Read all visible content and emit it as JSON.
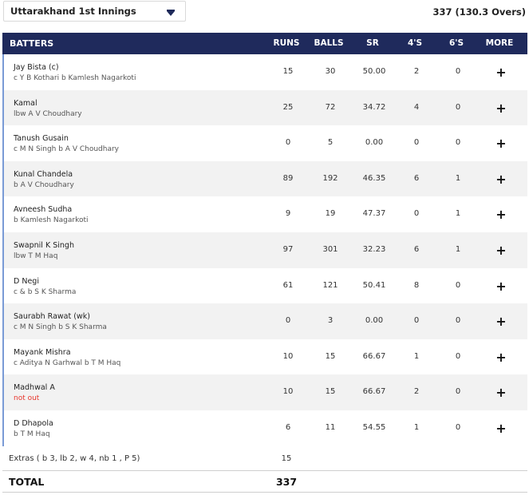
{
  "header": {
    "innings_select": "Uttarakhand 1st Innings",
    "score_summary": "337 (130.3 Overs)"
  },
  "columns": {
    "batters": "BATTERS",
    "runs": "RUNS",
    "balls": "BALLS",
    "sr": "SR",
    "fours": "4'S",
    "sixes": "6'S",
    "more": "MORE"
  },
  "batters": [
    {
      "name": "Jay Bista (c)",
      "dismissal": "c Y B Kothari b Kamlesh Nagarkoti",
      "runs": "15",
      "balls": "30",
      "sr": "50.00",
      "fours": "2",
      "sixes": "0"
    },
    {
      "name": "Kamal",
      "dismissal": "lbw A V Choudhary",
      "runs": "25",
      "balls": "72",
      "sr": "34.72",
      "fours": "4",
      "sixes": "0"
    },
    {
      "name": "Tanush Gusain",
      "dismissal": "c M N Singh b A V Choudhary",
      "runs": "0",
      "balls": "5",
      "sr": "0.00",
      "fours": "0",
      "sixes": "0"
    },
    {
      "name": "Kunal Chandela",
      "dismissal": "b A V Choudhary",
      "runs": "89",
      "balls": "192",
      "sr": "46.35",
      "fours": "6",
      "sixes": "1"
    },
    {
      "name": "Avneesh Sudha",
      "dismissal": "b Kamlesh Nagarkoti",
      "runs": "9",
      "balls": "19",
      "sr": "47.37",
      "fours": "0",
      "sixes": "1"
    },
    {
      "name": "Swapnil K Singh",
      "dismissal": "lbw T M Haq",
      "runs": "97",
      "balls": "301",
      "sr": "32.23",
      "fours": "6",
      "sixes": "1"
    },
    {
      "name": "D Negi",
      "dismissal": "c & b S K Sharma",
      "runs": "61",
      "balls": "121",
      "sr": "50.41",
      "fours": "8",
      "sixes": "0"
    },
    {
      "name": "Saurabh Rawat (wk)",
      "dismissal": "c M N Singh b S K Sharma",
      "runs": "0",
      "balls": "3",
      "sr": "0.00",
      "fours": "0",
      "sixes": "0"
    },
    {
      "name": "Mayank Mishra",
      "dismissal": "c Aditya N Garhwal b T M Haq",
      "runs": "10",
      "balls": "15",
      "sr": "66.67",
      "fours": "1",
      "sixes": "0"
    },
    {
      "name": "Madhwal A",
      "dismissal": "not out",
      "not_out": true,
      "runs": "10",
      "balls": "15",
      "sr": "66.67",
      "fours": "2",
      "sixes": "0"
    },
    {
      "name": "D Dhapola",
      "dismissal": "b T M Haq",
      "runs": "6",
      "balls": "11",
      "sr": "54.55",
      "fours": "1",
      "sixes": "0"
    }
  ],
  "more_icon": "plus-icon",
  "extras": {
    "label": "Extras ( b 3, lb 2, w 4, nb 1 , P 5)",
    "value": "15"
  },
  "total": {
    "label": "TOTAL",
    "value": "337"
  },
  "colors": {
    "header_bg": "#1f2a5c",
    "row_accent": "#7a9bd6",
    "not_out": "#e8352b",
    "alt_row": "#f2f2f2"
  }
}
